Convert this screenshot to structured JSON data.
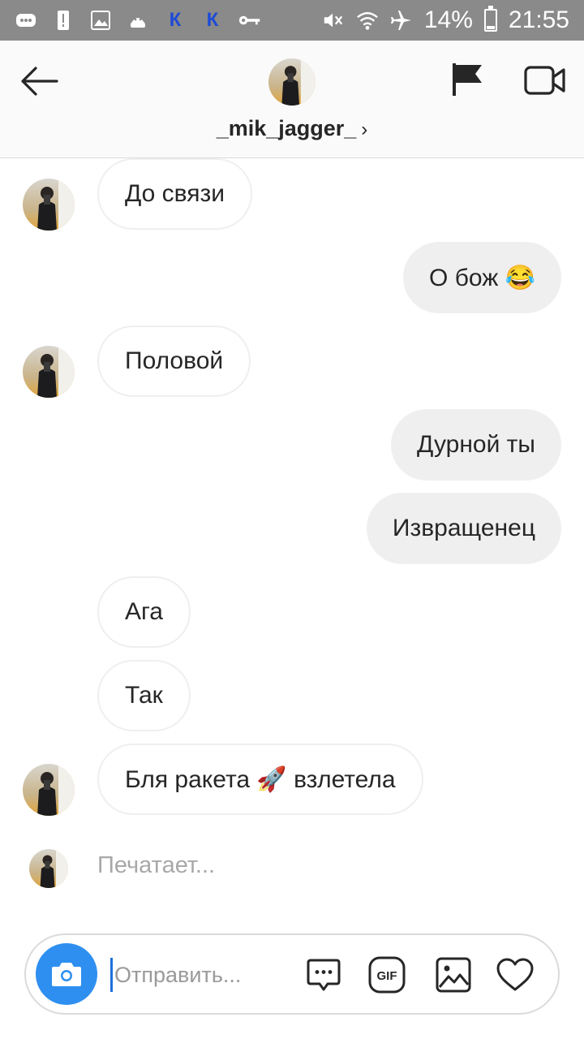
{
  "status_bar": {
    "k_label_1": "К",
    "k_label_2": "К",
    "battery": "14%",
    "time": "21:55"
  },
  "header": {
    "username": "_mik_jagger_",
    "chevron": "›"
  },
  "messages": [
    {
      "side": "incoming",
      "text": "До связи"
    },
    {
      "side": "outgoing",
      "text": "О бож 😂"
    },
    {
      "side": "incoming",
      "text": "Половой"
    },
    {
      "side": "outgoing",
      "text": "Дурной ты"
    },
    {
      "side": "outgoing",
      "text": "Извращенец"
    },
    {
      "side": "incoming",
      "text": "Ага"
    },
    {
      "side": "incoming",
      "text": "Так"
    },
    {
      "side": "incoming",
      "text": "Бля ракета 🚀 взлетела"
    }
  ],
  "typing_text": "Печатает...",
  "composer": {
    "placeholder": "Отправить..."
  },
  "colors": {
    "accent": "#2e8ff0",
    "outgoing_bubble": "#efefef",
    "incoming_border": "#efefef",
    "status_bar": "#8a8a8a"
  },
  "icons": [
    "back-arrow-icon",
    "flag-icon",
    "video-call-icon",
    "camera-icon",
    "sticker-icon",
    "gif-icon",
    "gallery-icon",
    "heart-icon"
  ]
}
